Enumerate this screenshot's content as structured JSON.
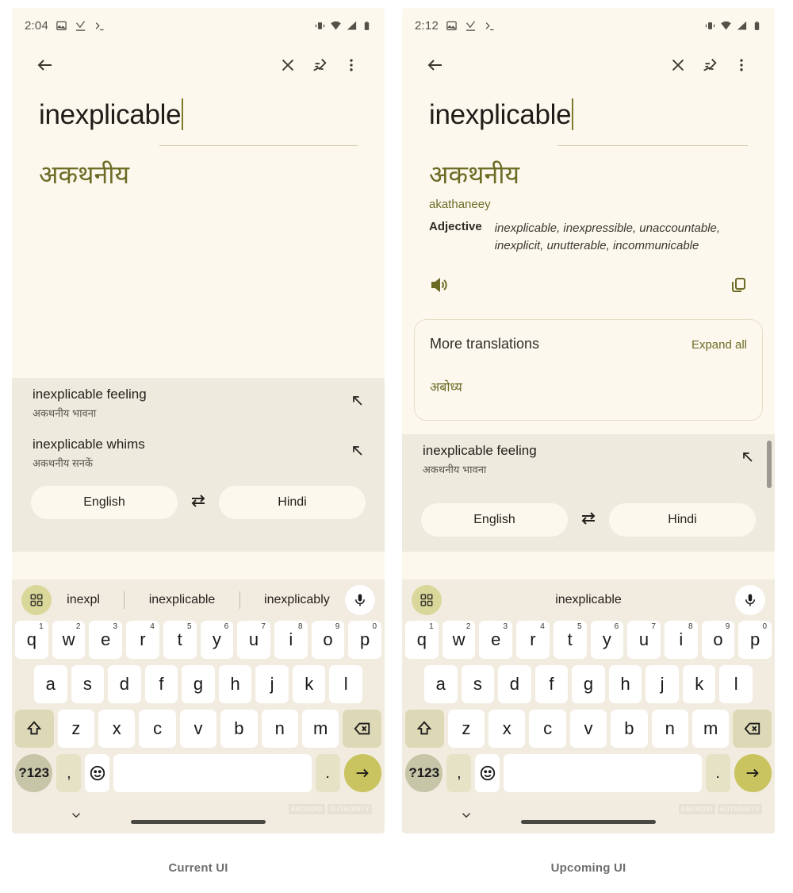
{
  "panels": [
    {
      "caption": "Current UI",
      "status": {
        "time": "2:04",
        "icons": [
          "image-icon",
          "download-complete-icon",
          "terminal-icon"
        ],
        "right_icons": [
          "vibrate-icon",
          "wifi-icon",
          "signal-icon",
          "battery-icon"
        ]
      },
      "appbar": {
        "back": "back-arrow-icon",
        "close": "close-icon",
        "handwriting": "handwriting-icon",
        "overflow": "overflow-menu-icon"
      },
      "source": {
        "text": "inexplicable"
      },
      "translation": {
        "hindi": "अकथनीय"
      },
      "suggestions": [
        {
          "en": "inexplicable feeling",
          "hi": "अकथनीय भावना"
        },
        {
          "en": "inexplicable whims",
          "hi": "अकथनीय सनकें"
        }
      ],
      "languages": {
        "source": "English",
        "target": "Hindi",
        "swap": "swap-languages-icon"
      },
      "keyboard": {
        "suggestion_words": [
          "inexpl",
          "inexplicable",
          "inexplicably"
        ],
        "grid": "keyboard-switch-icon",
        "mic": "microphone-icon",
        "row1": [
          {
            "k": "q",
            "n": "1"
          },
          {
            "k": "w",
            "n": "2"
          },
          {
            "k": "e",
            "n": "3"
          },
          {
            "k": "r",
            "n": "4"
          },
          {
            "k": "t",
            "n": "5"
          },
          {
            "k": "y",
            "n": "6"
          },
          {
            "k": "u",
            "n": "7"
          },
          {
            "k": "i",
            "n": "8"
          },
          {
            "k": "o",
            "n": "9"
          },
          {
            "k": "p",
            "n": "0"
          }
        ],
        "row2": [
          "a",
          "s",
          "d",
          "f",
          "g",
          "h",
          "j",
          "k",
          "l"
        ],
        "row3": [
          "z",
          "x",
          "c",
          "v",
          "b",
          "n",
          "m"
        ],
        "shift": "shift-icon",
        "backspace": "backspace-icon",
        "symbols": "?123",
        "comma": ",",
        "emoji": "emoji-icon",
        "space": "",
        "period": ".",
        "enter": "enter-arrow-icon"
      },
      "nav": {
        "chevron": "chevron-down-icon"
      },
      "watermark": [
        "ANDROID",
        "AUTHORITY"
      ]
    },
    {
      "caption": "Upcoming UI",
      "status": {
        "time": "2:12",
        "icons": [
          "image-icon",
          "download-complete-icon",
          "terminal-icon"
        ],
        "right_icons": [
          "vibrate-icon",
          "wifi-icon",
          "signal-icon",
          "battery-icon"
        ]
      },
      "appbar": {
        "back": "back-arrow-icon",
        "close": "close-icon",
        "handwriting": "handwriting-icon",
        "overflow": "overflow-menu-icon"
      },
      "source": {
        "text": "inexplicable"
      },
      "translation": {
        "hindi": "अकथनीय",
        "transliteration": "akathaneey",
        "part_of_speech": "Adjective",
        "definitions": "inexplicable, inexpressible, unaccountable, inexplicit, unutterable, incommunicable",
        "speaker": "speaker-icon",
        "copy": "copy-icon"
      },
      "more_translations": {
        "title": "More translations",
        "expand": "Expand all",
        "first_word": "अबोध्य"
      },
      "suggestions": [
        {
          "en": "inexplicable feeling",
          "hi": "अकथनीय भावना"
        }
      ],
      "languages": {
        "source": "English",
        "target": "Hindi",
        "swap": "swap-languages-icon"
      },
      "keyboard": {
        "suggestion_words": [
          "inexplicable"
        ],
        "grid": "keyboard-switch-icon",
        "mic": "microphone-icon",
        "row1": [
          {
            "k": "q",
            "n": "1"
          },
          {
            "k": "w",
            "n": "2"
          },
          {
            "k": "e",
            "n": "3"
          },
          {
            "k": "r",
            "n": "4"
          },
          {
            "k": "t",
            "n": "5"
          },
          {
            "k": "y",
            "n": "6"
          },
          {
            "k": "u",
            "n": "7"
          },
          {
            "k": "i",
            "n": "8"
          },
          {
            "k": "o",
            "n": "9"
          },
          {
            "k": "p",
            "n": "0"
          }
        ],
        "row2": [
          "a",
          "s",
          "d",
          "f",
          "g",
          "h",
          "j",
          "k",
          "l"
        ],
        "row3": [
          "z",
          "x",
          "c",
          "v",
          "b",
          "n",
          "m"
        ],
        "shift": "shift-icon",
        "backspace": "backspace-icon",
        "symbols": "?123",
        "comma": ",",
        "emoji": "emoji-icon",
        "space": "",
        "period": ".",
        "enter": "enter-arrow-icon"
      },
      "nav": {
        "chevron": "chevron-down-icon"
      },
      "watermark": [
        "ANDROID",
        "AUTHORITY"
      ]
    }
  ],
  "colors": {
    "background": "#fdf8ee",
    "accent_olive": "#6b6b24",
    "enter_key": "#c9c45f",
    "sheet": "#efeade",
    "keyboard_bg": "#f2ece0"
  }
}
